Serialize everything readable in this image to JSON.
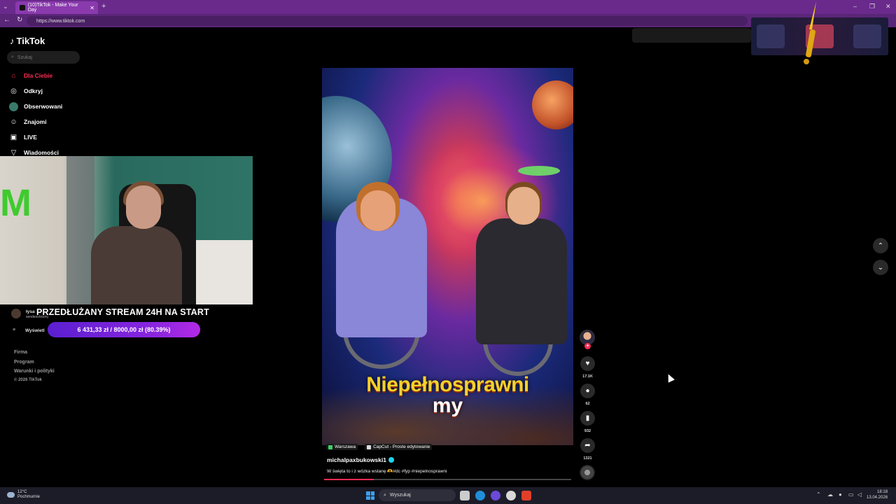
{
  "browser": {
    "tab_title": "(10)TikTok - Make Your Day",
    "url": "https://www.tiktok.com",
    "new_tab": "+",
    "tab_close": "✕"
  },
  "sidebar": {
    "logo": "TikTok",
    "search_placeholder": "Szukaj",
    "items": [
      {
        "label": "Dla Ciebie",
        "icon": "home-icon",
        "active": true
      },
      {
        "label": "Odkryj",
        "icon": "compass-icon"
      },
      {
        "label": "Obserwowani",
        "icon": "avatar-icon"
      },
      {
        "label": "Znajomi",
        "icon": "friends-icon"
      },
      {
        "label": "LIVE",
        "icon": "live-icon"
      },
      {
        "label": "Wiadomości",
        "icon": "message-icon"
      }
    ],
    "following_user": "łysa",
    "following_sub": "sendesxhxxmj",
    "see_more": "Wyświetl",
    "footer_links": [
      "Firma",
      "Program",
      "Warunki i polityki"
    ],
    "copyright": "© 2026 TikTok"
  },
  "overlay": {
    "banner": "PRZEDŁUŻANY STREAM 24H NA START",
    "progress_text": "6 431,33 zł / 8000,00 zł (80.39%)",
    "progress_fraction": 0.8039,
    "cam_logo": "M"
  },
  "video": {
    "title_line1": "Niepełnosprawni",
    "title_line2": "my",
    "tag_location": "Warszawa",
    "tag_app": "CapCut - Proste edytowanie",
    "author": "michalpaxbukowski1",
    "caption": "W święta to i z wózka wstanę 🫶#dc #fyp #niepelnosprawni",
    "playback_progress": 0.2
  },
  "actions": {
    "likes": "17.1K",
    "comments": "62",
    "saves": "932",
    "shares": "1321"
  },
  "taskbar": {
    "temp": "12°C",
    "weather": "Pochmurnie",
    "search": "Wyszukaj",
    "time": "18:18",
    "date": "13.04.2026"
  },
  "colors": {
    "accent": "#fe2c55",
    "browser_bar": "#6a2a8c",
    "progress_pill": "#8a25e0"
  }
}
